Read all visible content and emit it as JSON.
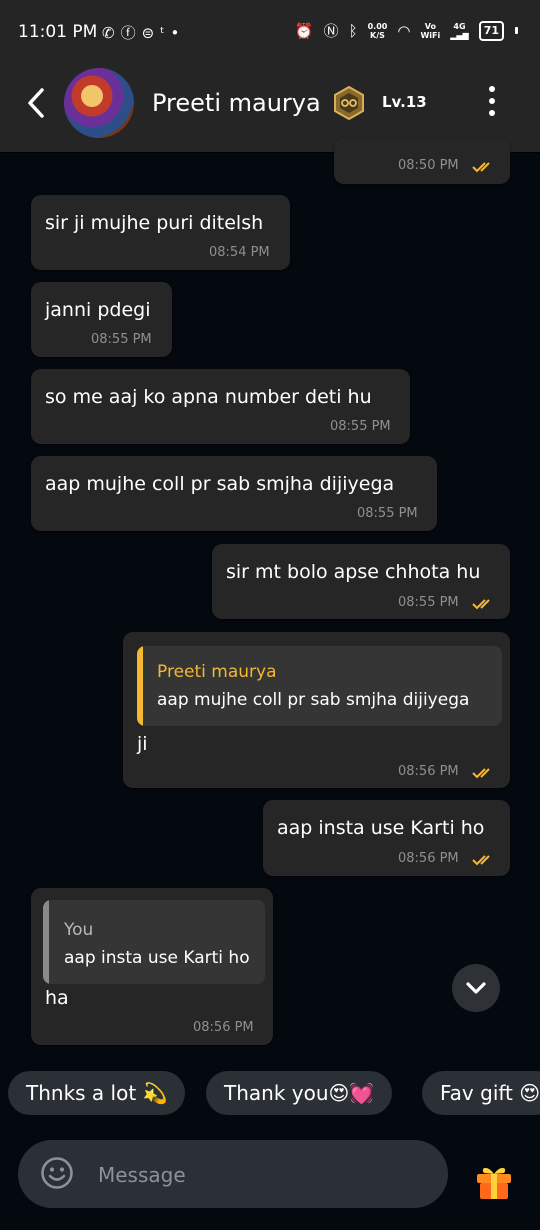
{
  "status": {
    "time": "11:01 PM",
    "speed_top": "0.00",
    "speed_bottom": "K/S",
    "volte_top": "Vo",
    "volte_bottom": "WiFi",
    "network": "4G",
    "battery": "71"
  },
  "header": {
    "name": "Preeti maurya",
    "level": "Lv.13"
  },
  "messages": [
    {
      "time": "08:50 PM"
    },
    {
      "text": "sir ji mujhe puri ditelsh",
      "time": "08:54 PM"
    },
    {
      "text": "janni pdegi",
      "time": "08:55 PM"
    },
    {
      "text": "so me aaj ko apna number deti hu",
      "time": "08:55 PM"
    },
    {
      "text": "aap mujhe coll pr sab smjha dijiyega",
      "time": "08:55 PM"
    },
    {
      "text": "sir mt bolo apse chhota hu",
      "time": "08:55 PM"
    },
    {
      "quote_name": "Preeti maurya",
      "quote_text": "aap mujhe coll pr sab smjha dijiyega",
      "text": "ji",
      "time": "08:56 PM"
    },
    {
      "text": "aap insta use Karti ho",
      "time": "08:56 PM"
    },
    {
      "quote_name": "You",
      "quote_text": "aap insta use Karti ho",
      "text": "ha",
      "time": "08:56 PM"
    }
  ],
  "quick_replies": [
    "Thnks a lot 💫",
    "Thank you😍💓",
    "Fav gift 😍"
  ],
  "composer": {
    "placeholder": "Message"
  },
  "colors": {
    "accent": "#f5b82e",
    "tick": "#f5b82e",
    "quote_bar_you": "#8a8a8a"
  }
}
